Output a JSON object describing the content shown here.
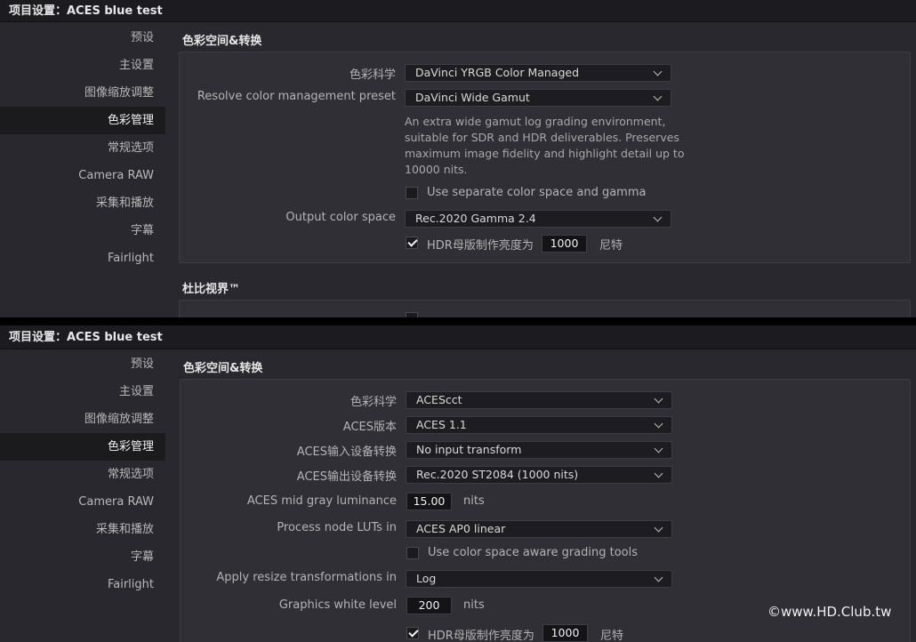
{
  "panel_top": {
    "title": "项目设置：ACES blue test",
    "sidebar": [
      "预设",
      "主设置",
      "图像缩放调整",
      "色彩管理",
      "常规选项",
      "Camera RAW",
      "采集和播放",
      "字幕",
      "Fairlight"
    ],
    "active_index": 3,
    "section_title": "色彩空间&转换",
    "color_science_label": "色彩科学",
    "color_science_value": "DaVinci YRGB Color Managed",
    "preset_label": "Resolve color management preset",
    "preset_value": "DaVinci Wide Gamut",
    "description_lines": [
      "An extra wide gamut log grading environment,",
      "suitable for SDR and HDR deliverables. Preserves",
      "maximum image fidelity and highlight detail up to",
      "10000 nits."
    ],
    "separate_cs_label": "Use separate color space and gamma",
    "separate_cs_checked": false,
    "output_cs_label": "Output color space",
    "output_cs_value": "Rec.2020 Gamma 2.4",
    "hdr_label": "HDR母版制作亮度为",
    "hdr_checked": true,
    "hdr_value": "1000",
    "hdr_unit": "尼特",
    "section2_title": "杜比视界™"
  },
  "panel_bottom": {
    "title": "项目设置：ACES blue test",
    "sidebar": [
      "预设",
      "主设置",
      "图像缩放调整",
      "色彩管理",
      "常规选项",
      "Camera RAW",
      "采集和播放",
      "字幕",
      "Fairlight"
    ],
    "active_index": 3,
    "section_title": "色彩空间&转换",
    "color_science_label": "色彩科学",
    "color_science_value": "ACEScct",
    "aces_version_label": "ACES版本",
    "aces_version_value": "ACES 1.1",
    "aces_idt_label": "ACES输入设备转换",
    "aces_idt_value": "No input transform",
    "aces_odt_label": "ACES输出设备转换",
    "aces_odt_value": "Rec.2020 ST2084 (1000 nits)",
    "mid_gray_label": "ACES mid gray luminance",
    "mid_gray_value": "15.00",
    "mid_gray_unit": "nits",
    "process_luts_label": "Process node LUTs in",
    "process_luts_value": "ACES AP0 linear",
    "cs_aware_label": "Use color space aware grading tools",
    "cs_aware_checked": false,
    "resize_label": "Apply resize transformations in",
    "resize_value": "Log",
    "graphics_white_label": "Graphics white level",
    "graphics_white_value": "200",
    "graphics_white_unit": "nits",
    "hdr_label": "HDR母版制作亮度为",
    "hdr_checked": true,
    "hdr_value": "1000",
    "hdr_unit": "尼特"
  },
  "watermark": "©www.HD.Club.tw",
  "colors": {
    "panel_bg": "#28282e",
    "title_bg": "#1c1c20",
    "active_item_bg": "#1b1b1e",
    "section_box_bg": "#2f2f35",
    "dropdown_bg": "#1d1d21",
    "divider": "#000000"
  },
  "icons": [
    "chevron-down-icon",
    "checkmark-icon"
  ]
}
